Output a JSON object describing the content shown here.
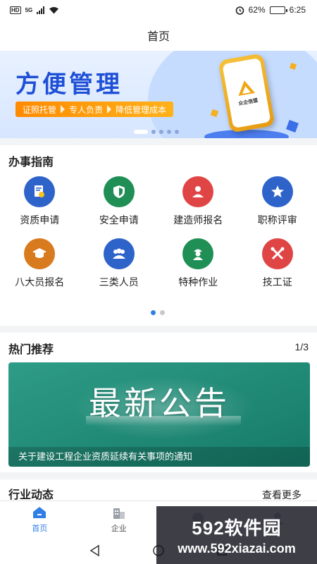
{
  "status_bar": {
    "network_label": "HD",
    "network_type": "5G",
    "battery_text": "62%",
    "battery_level": 0.62,
    "time": "6:25"
  },
  "header": {
    "title": "首页"
  },
  "banner": {
    "title": "方便管理",
    "tags": [
      "证照托管",
      "专人负责",
      "降低管理成本"
    ],
    "logo_text": "众企信盟",
    "slide_count": 5,
    "active_slide": 0
  },
  "guide": {
    "title": "办事指南",
    "items": [
      {
        "label": "资质申请",
        "icon": "certificate-icon",
        "color": "#2e63c9"
      },
      {
        "label": "安全申请",
        "icon": "shield-icon",
        "color": "#1f8f55"
      },
      {
        "label": "建造师报名",
        "icon": "person-icon",
        "color": "#e04545"
      },
      {
        "label": "职称评审",
        "icon": "star-badge-icon",
        "color": "#2e63c9"
      },
      {
        "label": "八大员报名",
        "icon": "graduation-cap-icon",
        "color": "#d87a1e"
      },
      {
        "label": "三类人员",
        "icon": "group-icon",
        "color": "#2e63c9"
      },
      {
        "label": "特种作业",
        "icon": "worker-icon",
        "color": "#1f8f55"
      },
      {
        "label": "技工证",
        "icon": "tools-icon",
        "color": "#e04545"
      }
    ],
    "page_count": 2,
    "active_page": 0
  },
  "hot": {
    "title": "热门推荐",
    "counter": "1/3",
    "banner_text": "最新公告",
    "caption": "关于建设工程企业资质延续有关事项的通知"
  },
  "industry": {
    "title": "行业动态",
    "see_more": "查看更多"
  },
  "tabbar": {
    "items": [
      {
        "label": "首页",
        "icon": "home-icon",
        "active": true
      },
      {
        "label": "企业",
        "icon": "building-icon",
        "active": false
      },
      {
        "label": "",
        "icon": "circle-icon",
        "active": false
      },
      {
        "label": "",
        "icon": "user-icon",
        "active": false
      }
    ]
  },
  "watermark": {
    "brand": "592软件园",
    "url": "www.592xiazai.com"
  },
  "colors": {
    "accent": "#2f7fe6",
    "banner_title": "#1f4fd6",
    "notice_green": "#1b8a74",
    "tag_orange": "#ff9a10"
  }
}
